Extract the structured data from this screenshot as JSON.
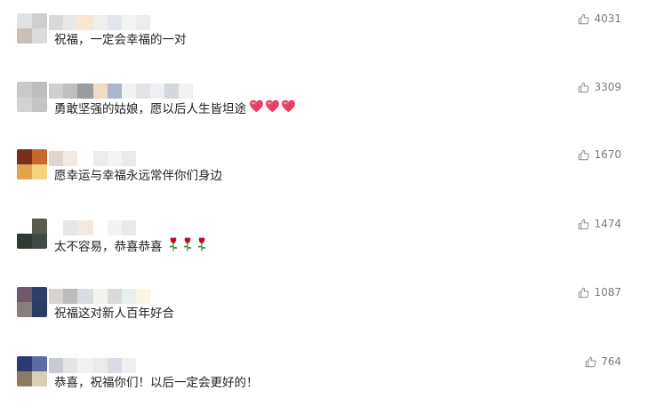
{
  "comments": [
    {
      "text": "祝福，一定会幸福的一对",
      "likes": "4031",
      "emoji": "",
      "emoji_count": 0,
      "avatar_colors": [
        "#e2e2e2",
        "#cfcfcf",
        "#c9bfb8",
        "#dcdcdc"
      ],
      "name_colors": [
        "#d9d9d9",
        "#e8e8e8",
        "#f7e7d4",
        "#efefef",
        "#e3e6ec",
        "#f4f4f4",
        "#ececec"
      ]
    },
    {
      "text": "勇敢坚强的姑娘，愿以后人生皆坦途",
      "likes": "3309",
      "emoji": "heart",
      "emoji_count": 3,
      "avatar_colors": [
        "#c9c9c9",
        "#bdbdbd",
        "#d2d2d2",
        "#c4c4c4"
      ],
      "name_colors": [
        "#cfcfcf",
        "#bfbfbf",
        "#9a9c9f",
        "#f0dcc6",
        "#a9b7c9",
        "#f2f2f2",
        "#e4e4e4",
        "#eceff4",
        "#d3d7de",
        "#f1f1f1"
      ]
    },
    {
      "text": "愿幸运与幸福永远常伴你们身边",
      "likes": "1670",
      "emoji": "",
      "emoji_count": 0,
      "avatar_colors": [
        "#7a2f1c",
        "#c6682d",
        "#e2a34a",
        "#f3d27c"
      ],
      "name_colors": [
        "#e4d5cb",
        "#f2e9e2",
        "#ffffff",
        "#ececec",
        "#f7f3ef",
        "#eaeaea"
      ]
    },
    {
      "text": "太不容易，恭喜恭喜",
      "likes": "1474",
      "emoji": "rose",
      "emoji_count": 3,
      "avatar_colors": [
        "#ffffff",
        "#5a5a50",
        "#2f3b32",
        "#3f4a44"
      ],
      "name_colors": [
        "#ffffff",
        "#e6e6e6",
        "#f1e8e0",
        "#ffffff",
        "#f2f2f2",
        "#e9e9e9"
      ]
    },
    {
      "text": "祝福这对新人百年好合",
      "likes": "1087",
      "emoji": "",
      "emoji_count": 0,
      "avatar_colors": [
        "#6e5a6b",
        "#2d3f6b",
        "#8a7d7e",
        "#2c3d63"
      ],
      "name_colors": [
        "#d8d3d1",
        "#bcbcbc",
        "#d7dde2",
        "#f5f3ee",
        "#dadada",
        "#e8eef0",
        "#fbf6e4"
      ]
    },
    {
      "text": "恭喜，祝福你们！以后一定会更好的！",
      "likes": "764",
      "emoji": "",
      "emoji_count": 0,
      "avatar_colors": [
        "#2b3c74",
        "#5b6ea3",
        "#8a7d62",
        "#d8cfb3"
      ],
      "name_colors": [
        "#c9cbd4",
        "#e4e4e4",
        "#f1f1f1",
        "#eaeaea",
        "#d9dce4",
        "#efefef"
      ]
    }
  ],
  "icons": {
    "like": "thumbs-up-icon",
    "heart": "heart-icon",
    "rose": "rose-icon"
  },
  "colors": {
    "text": "#222222",
    "likes": "#7a7a7a",
    "heart": "#ea3f63",
    "rose_petal": "#c0152b",
    "rose_leaf": "#2f8a2f"
  }
}
